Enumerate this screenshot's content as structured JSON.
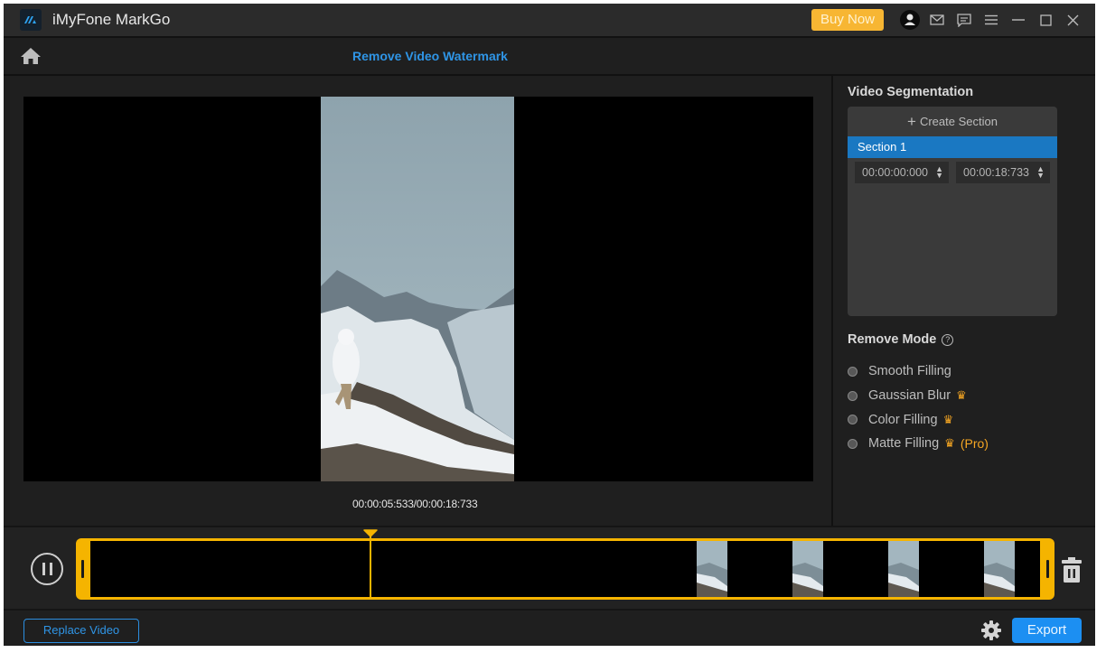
{
  "app": {
    "title": "iMyFone MarkGo",
    "buy_now_label": "Buy Now",
    "titlebar_icons": [
      "account-icon",
      "mail-icon",
      "feedback-icon",
      "menu-icon",
      "minimize-icon",
      "maximize-icon",
      "close-icon"
    ]
  },
  "header": {
    "page_title": "Remove Video Watermark"
  },
  "preview": {
    "current_time": "00:00:05:533",
    "total_time": "00:00:18:733",
    "time_readout": "00:00:05:533/00:00:18:733"
  },
  "segmentation": {
    "title": "Video Segmentation",
    "create_label": "Create Section",
    "sections": [
      {
        "label": "Section 1",
        "start": "00:00:00:000",
        "end": "00:00:18:733",
        "selected": true
      }
    ]
  },
  "remove_mode": {
    "title": "Remove Mode",
    "options": [
      {
        "label": "Smooth Filling",
        "premium": false,
        "pro": ""
      },
      {
        "label": "Gaussian Blur",
        "premium": true,
        "pro": ""
      },
      {
        "label": "Color Filling",
        "premium": true,
        "pro": ""
      },
      {
        "label": "Matte Filling",
        "premium": true,
        "pro": "(Pro)"
      }
    ]
  },
  "timeline": {
    "playhead_fraction": 0.295,
    "accent_color": "#f5b400"
  },
  "footer": {
    "replace_label": "Replace Video",
    "export_label": "Export"
  },
  "colors": {
    "accent_blue": "#1c8ff2",
    "section_blue": "#1a78c2",
    "buy_now": "#f7b633",
    "premium": "#f5a623"
  }
}
